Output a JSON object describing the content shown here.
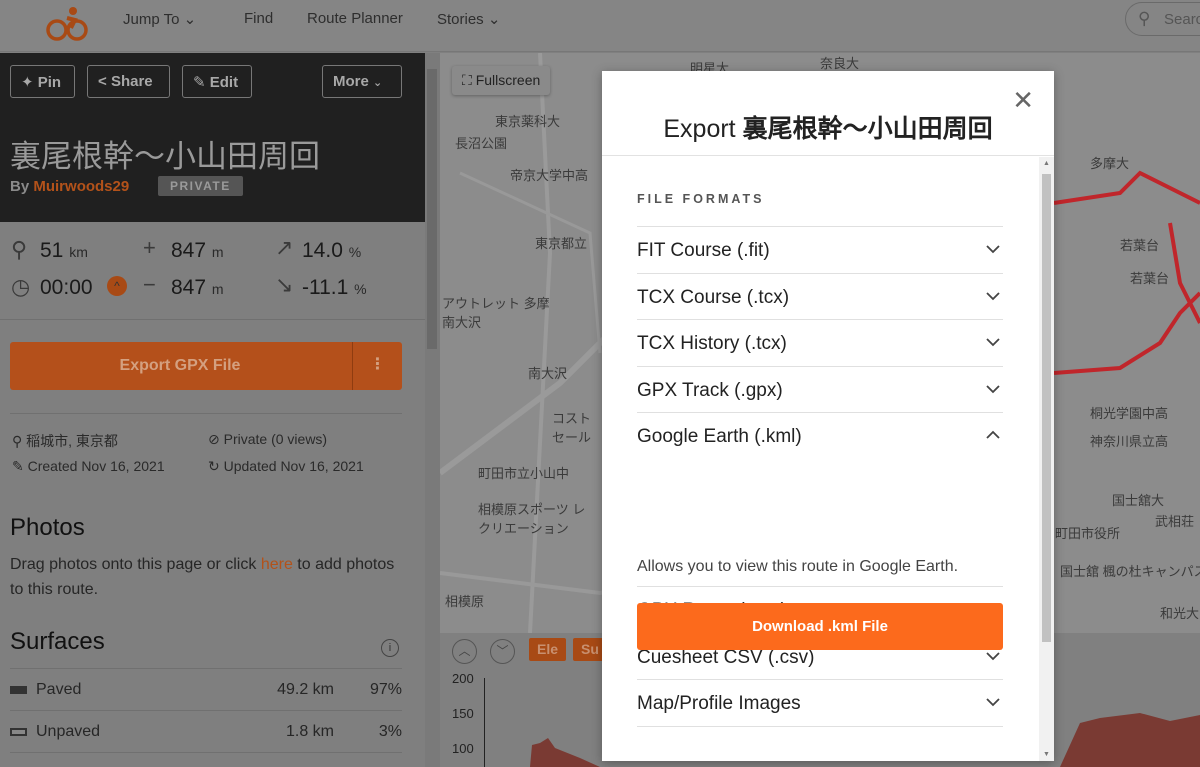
{
  "nav": {
    "jump_to": "Jump To",
    "find": "Find",
    "route_planner": "Route Planner",
    "stories": "Stories",
    "search_placeholder": "Search"
  },
  "route": {
    "actions": {
      "pin": "Pin",
      "share": "Share",
      "edit": "Edit",
      "more": "More"
    },
    "title": "裏尾根幹〜小山田周回",
    "by": "By",
    "author": "Muirwoods29",
    "badge": "PRIVATE",
    "stats": {
      "distance": "51",
      "distance_unit": "km",
      "elev_gain": "847",
      "elev_gain_unit": "m",
      "max_grade": "14.0",
      "max_grade_unit": "%",
      "time": "00:00",
      "elev_loss": "847",
      "elev_loss_unit": "m",
      "min_grade": "-11.1",
      "min_grade_unit": "%"
    },
    "export_button": "Export GPX File",
    "location": "稲城市, 東京都",
    "privacy": "Private (0 views)",
    "created": "Created Nov 16, 2021",
    "updated": "Updated Nov 16, 2021"
  },
  "photos": {
    "heading": "Photos",
    "text_before": "Drag photos onto this page or click ",
    "link": "here",
    "text_after": " to add photos to this route."
  },
  "surfaces": {
    "heading": "Surfaces",
    "rows": [
      {
        "label": "Paved",
        "distance": "49.2 km",
        "percent": "97%"
      },
      {
        "label": "Unpaved",
        "distance": "1.8 km",
        "percent": "3%"
      }
    ]
  },
  "map": {
    "fullscreen": "Fullscreen",
    "labels": [
      "長沼公園",
      "東京薬科大",
      "帝京大学中高",
      "東京都立",
      "アウトレット 多摩南大沢",
      "南大沢",
      "コスト セール",
      "町田市立小山中",
      "相模原スポーツ レクリエーション",
      "相模原",
      "奈良大",
      "明星大",
      "多摩大",
      "若葉台",
      "若葉台",
      "桐光学園中高",
      "神奈川県立高",
      "国士舘大",
      "武相荘",
      "町田市役所",
      "国士舘 楓の杜キャンパス",
      "和光大"
    ]
  },
  "profile": {
    "tabs": [
      "Ele",
      "Su"
    ],
    "y_ticks": [
      "200",
      "150",
      "100"
    ]
  },
  "modal": {
    "title_prefix": "Export",
    "title_name": "裏尾根幹〜小山田周回",
    "section": "FILE FORMATS",
    "formats": [
      {
        "label": "FIT Course (.fit)",
        "expanded": false
      },
      {
        "label": "TCX Course (.tcx)",
        "expanded": false
      },
      {
        "label": "TCX History (.tcx)",
        "expanded": false
      },
      {
        "label": "GPX Track (.gpx)",
        "expanded": false
      },
      {
        "label": "Google Earth (.kml)",
        "expanded": true
      },
      {
        "label": "GPX Route (.gpx)",
        "expanded": false
      },
      {
        "label": "Cuesheet CSV (.csv)",
        "expanded": false
      },
      {
        "label": "Map/Profile Images",
        "expanded": false
      }
    ],
    "expanded_description": "Allows you to view this route in Google Earth.",
    "download_button": "Download .kml File"
  },
  "colors": {
    "brand": "#fc6a1c",
    "route_line": "#c0262b"
  }
}
